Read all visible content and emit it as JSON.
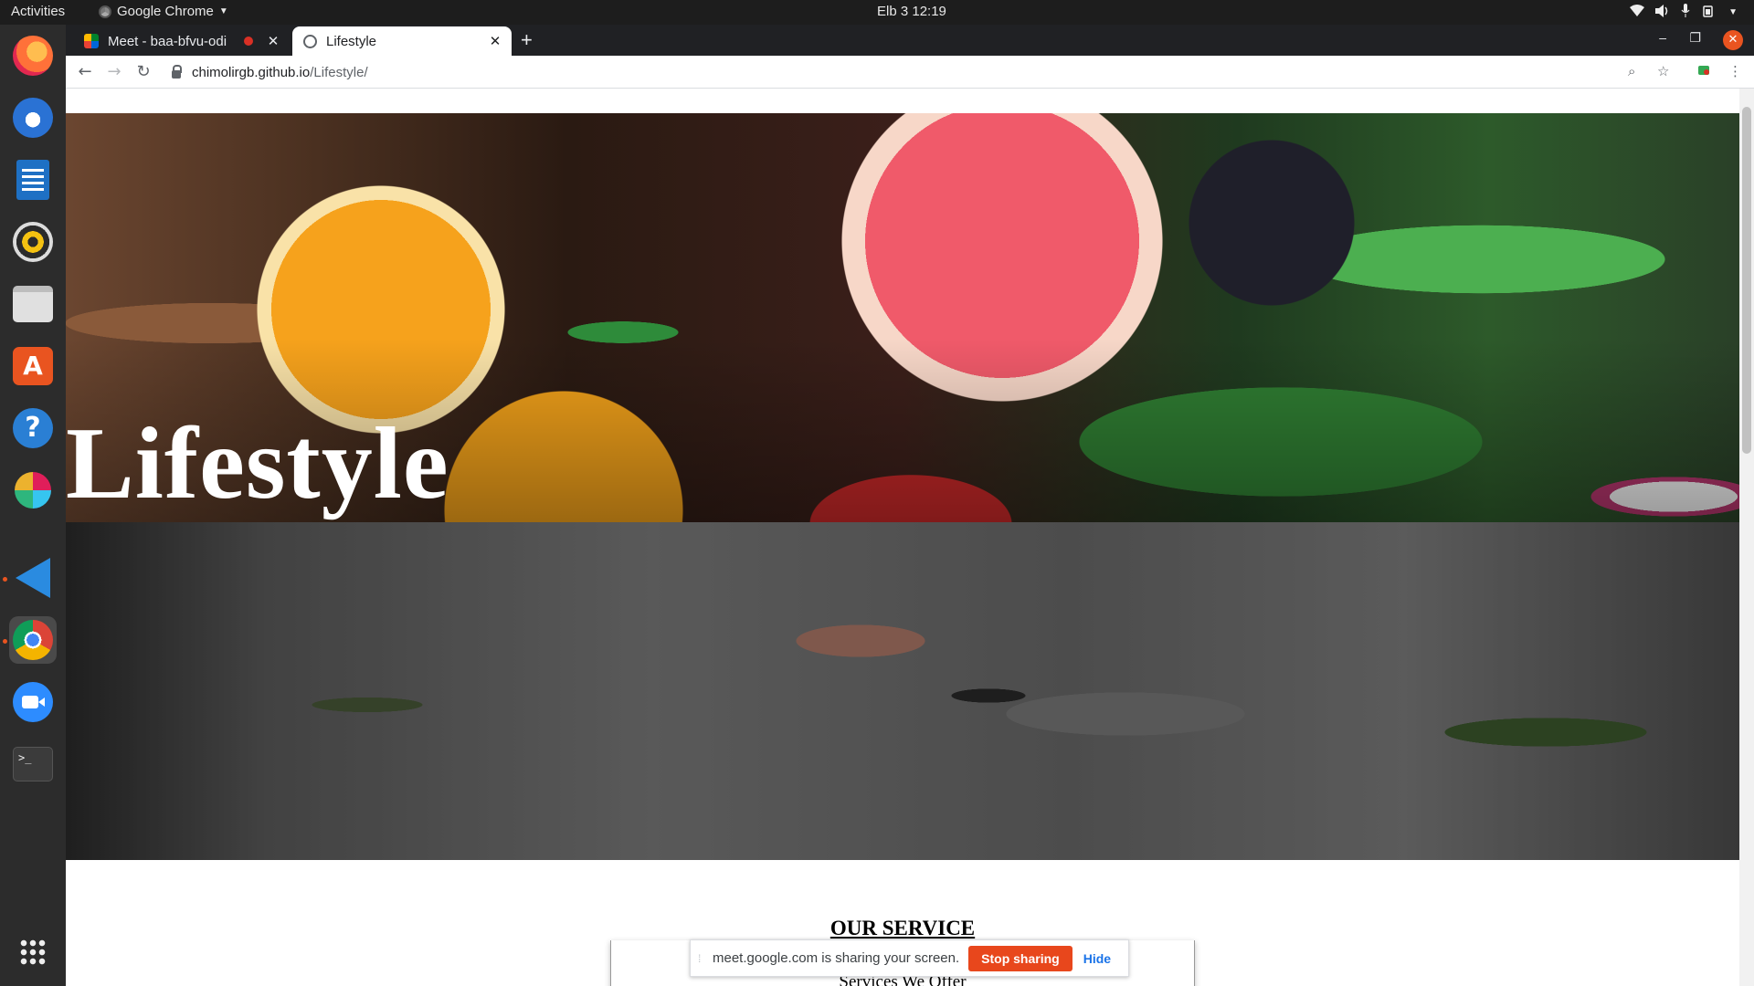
{
  "topbar": {
    "activities": "Activities",
    "app_name": "Google Chrome",
    "clock": "Elb 3  12:19"
  },
  "dock": {
    "items": [
      "firefox-icon",
      "thunderbird-icon",
      "libreoffice-writer-icon",
      "rhythmbox-icon",
      "files-icon",
      "software-center-icon",
      "help-icon",
      "slack-icon",
      "vscode-icon",
      "chrome-icon",
      "zoom-icon",
      "terminal-icon",
      "app-grid-icon"
    ]
  },
  "browser": {
    "tabs": [
      {
        "title": "Meet - baa-bfvu-odi",
        "active": false
      },
      {
        "title": "Lifestyle",
        "active": true
      }
    ],
    "url_host": "chimolirgb.github.io",
    "url_path": "/Lifestyle/"
  },
  "page": {
    "hero_title": "Lifestyle",
    "section_heading": "OUR SERVICE",
    "section_subheading": "Services We Offer"
  },
  "sharebar": {
    "message": "meet.google.com is sharing your screen.",
    "stop_label": "Stop sharing",
    "hide_label": "Hide"
  },
  "colors": {
    "accent": "#e95420",
    "stop_button": "#e8471c",
    "link": "#1a73e8"
  }
}
